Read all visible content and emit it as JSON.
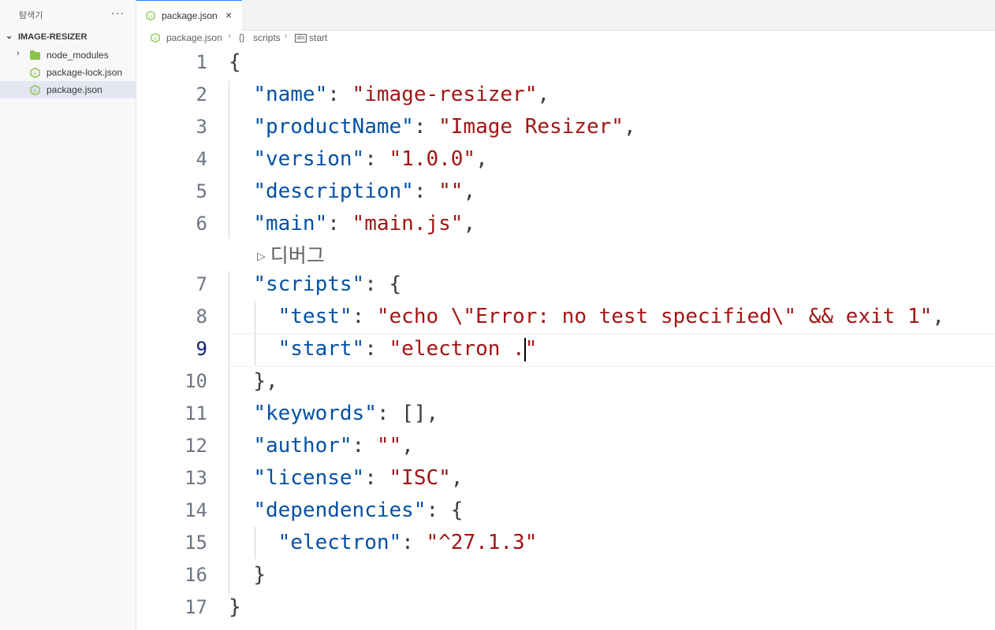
{
  "sidebar": {
    "header": "탐색기",
    "more": "···",
    "root": "IMAGE-RESIZER",
    "items": [
      {
        "label": "node_modules",
        "type": "folder"
      },
      {
        "label": "package-lock.json",
        "type": "json"
      },
      {
        "label": "package.json",
        "type": "json",
        "selected": true
      }
    ]
  },
  "tab": {
    "label": "package.json",
    "close": "×"
  },
  "breadcrumb": {
    "file": "package.json",
    "sep": "›",
    "scripts_icon": "{}",
    "scripts": "scripts",
    "start_icon": "abc",
    "start": "start"
  },
  "codelens": {
    "label": "디버그"
  },
  "line_numbers": [
    "1",
    "2",
    "3",
    "4",
    "5",
    "6",
    "7",
    "8",
    "9",
    "10",
    "11",
    "12",
    "13",
    "14",
    "15",
    "16",
    "17"
  ],
  "active_line": "9",
  "code": {
    "l1": {
      "p": "{"
    },
    "l2": {
      "key": "\"name\"",
      "sep": ": ",
      "val": "\"image-resizer\"",
      "end": ","
    },
    "l3": {
      "key": "\"productName\"",
      "sep": ": ",
      "val": "\"Image Resizer\"",
      "end": ","
    },
    "l4": {
      "key": "\"version\"",
      "sep": ": ",
      "val": "\"1.0.0\"",
      "end": ","
    },
    "l5": {
      "key": "\"description\"",
      "sep": ": ",
      "val": "\"\"",
      "end": ","
    },
    "l6": {
      "key": "\"main\"",
      "sep": ": ",
      "val": "\"main.js\"",
      "end": ","
    },
    "l7": {
      "key": "\"scripts\"",
      "sep": ": {"
    },
    "l8": {
      "key": "\"test\"",
      "sep": ": ",
      "val": "\"echo \\\"Error: no test specified\\\" && exit 1\"",
      "end": ","
    },
    "l9": {
      "key": "\"start\"",
      "sep": ": ",
      "val_a": "\"electron .",
      "val_b": "\""
    },
    "l10": {
      "p": "},"
    },
    "l11": {
      "key": "\"keywords\"",
      "sep": ": [],"
    },
    "l12": {
      "key": "\"author\"",
      "sep": ": ",
      "val": "\"\"",
      "end": ","
    },
    "l13": {
      "key": "\"license\"",
      "sep": ": ",
      "val": "\"ISC\"",
      "end": ","
    },
    "l14": {
      "key": "\"dependencies\"",
      "sep": ": {"
    },
    "l15": {
      "key": "\"electron\"",
      "sep": ": ",
      "val": "\"^27.1.3\""
    },
    "l16": {
      "p": "}"
    },
    "l17": {
      "p": "}"
    }
  },
  "colors": {
    "key": "#0451a5",
    "string": "#a31515",
    "punct": "#3b3b3b",
    "tab_accent": "#1a85ff",
    "json_icon": "#8bc34a"
  }
}
